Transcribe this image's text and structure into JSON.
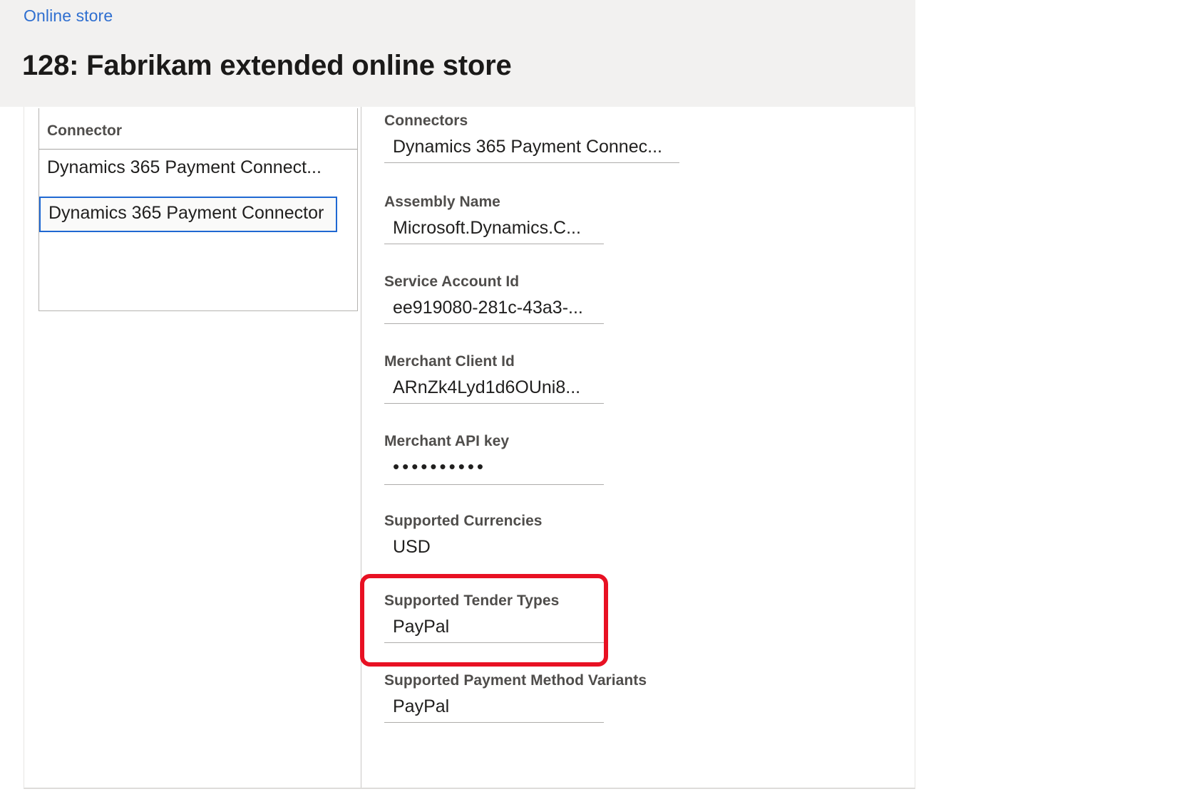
{
  "header": {
    "breadcrumb": "Online store",
    "title": "128: Fabrikam extended online store"
  },
  "connector_list": {
    "column_header": "Connector",
    "rows": [
      {
        "label": "Dynamics 365 Payment Connect...",
        "selected": false
      },
      {
        "label": "Dynamics 365 Payment Connector",
        "selected": true
      }
    ]
  },
  "form": {
    "fields": [
      {
        "label": "Connectors",
        "value": "Dynamics 365 Payment Connec..."
      },
      {
        "label": "Assembly Name",
        "value": "Microsoft.Dynamics.C..."
      },
      {
        "label": "Service Account Id",
        "value": "ee919080-281c-43a3-..."
      },
      {
        "label": "Merchant Client Id",
        "value": "ARnZk4Lyd1d6OUni8..."
      },
      {
        "label": "Merchant API key",
        "value": "••••••••••"
      },
      {
        "label": "Supported Currencies",
        "value": "USD"
      },
      {
        "label": "Supported Tender Types",
        "value": "PayPal"
      },
      {
        "label": "Supported Payment Method Variants",
        "value": "PayPal"
      }
    ]
  },
  "annotation": {
    "highlight_color": "#e81123",
    "highlights_field": "Supported Tender Types"
  },
  "colors": {
    "link": "#2f6fd0",
    "header_band": "#f2f1f0",
    "selection_border": "#1f68d2",
    "label_text": "#4f4d4b",
    "value_text": "#201f1e"
  }
}
